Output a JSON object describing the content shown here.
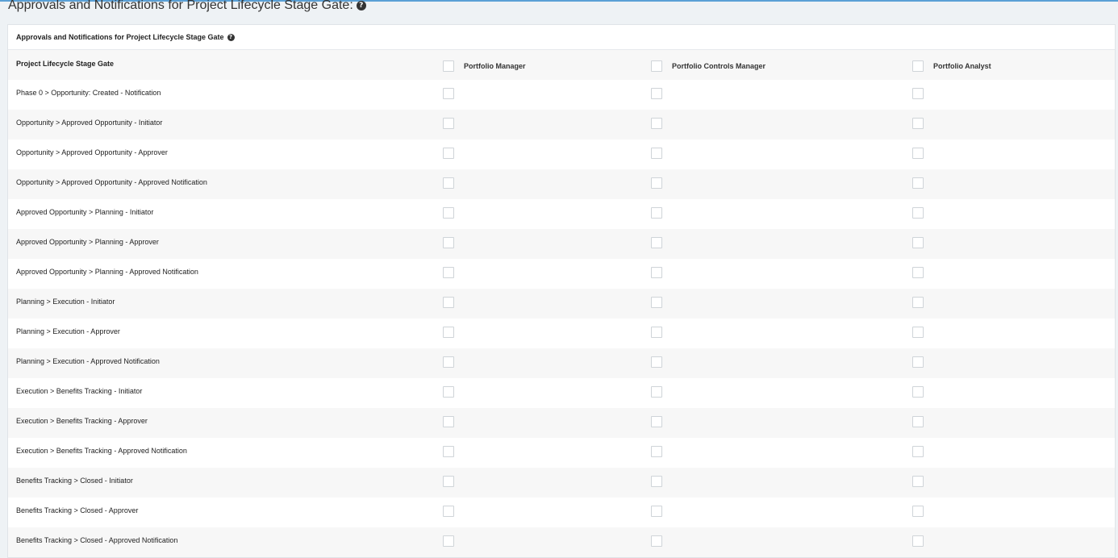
{
  "page": {
    "title": "Approvals and Notifications for Project Lifecycle Stage Gate:",
    "help_icon": "question-circle-icon"
  },
  "panel": {
    "title": "Approvals and Notifications for Project Lifecycle Stage Gate"
  },
  "grid": {
    "row_header": "Project Lifecycle Stage Gate",
    "columns": [
      "Portfolio Manager",
      "Portfolio Controls Manager",
      "Portfolio Analyst"
    ],
    "rows": [
      {
        "label": "Phase 0 > Opportunity: Created - Notification",
        "checked": [
          false,
          false,
          false
        ]
      },
      {
        "label": "Opportunity > Approved Opportunity - Initiator",
        "checked": [
          false,
          false,
          false
        ]
      },
      {
        "label": "Opportunity > Approved Opportunity - Approver",
        "checked": [
          false,
          false,
          false
        ]
      },
      {
        "label": "Opportunity > Approved Opportunity - Approved Notification",
        "checked": [
          false,
          false,
          false
        ]
      },
      {
        "label": "Approved Opportunity > Planning - Initiator",
        "checked": [
          false,
          false,
          false
        ]
      },
      {
        "label": "Approved Opportunity > Planning - Approver",
        "checked": [
          false,
          false,
          false
        ]
      },
      {
        "label": "Approved Opportunity > Planning - Approved Notification",
        "checked": [
          false,
          false,
          false
        ]
      },
      {
        "label": "Planning > Execution - Initiator",
        "checked": [
          false,
          false,
          false
        ]
      },
      {
        "label": "Planning > Execution - Approver",
        "checked": [
          false,
          false,
          false
        ]
      },
      {
        "label": "Planning > Execution - Approved Notification",
        "checked": [
          false,
          false,
          false
        ]
      },
      {
        "label": "Execution > Benefits Tracking - Initiator",
        "checked": [
          false,
          false,
          false
        ]
      },
      {
        "label": "Execution > Benefits Tracking - Approver",
        "checked": [
          false,
          false,
          false
        ]
      },
      {
        "label": "Execution > Benefits Tracking - Approved Notification",
        "checked": [
          false,
          false,
          false
        ]
      },
      {
        "label": "Benefits Tracking > Closed - Initiator",
        "checked": [
          false,
          false,
          false
        ]
      },
      {
        "label": "Benefits Tracking > Closed - Approver",
        "checked": [
          false,
          false,
          false
        ]
      },
      {
        "label": "Benefits Tracking > Closed - Approved Notification",
        "checked": [
          false,
          false,
          false
        ]
      }
    ]
  }
}
